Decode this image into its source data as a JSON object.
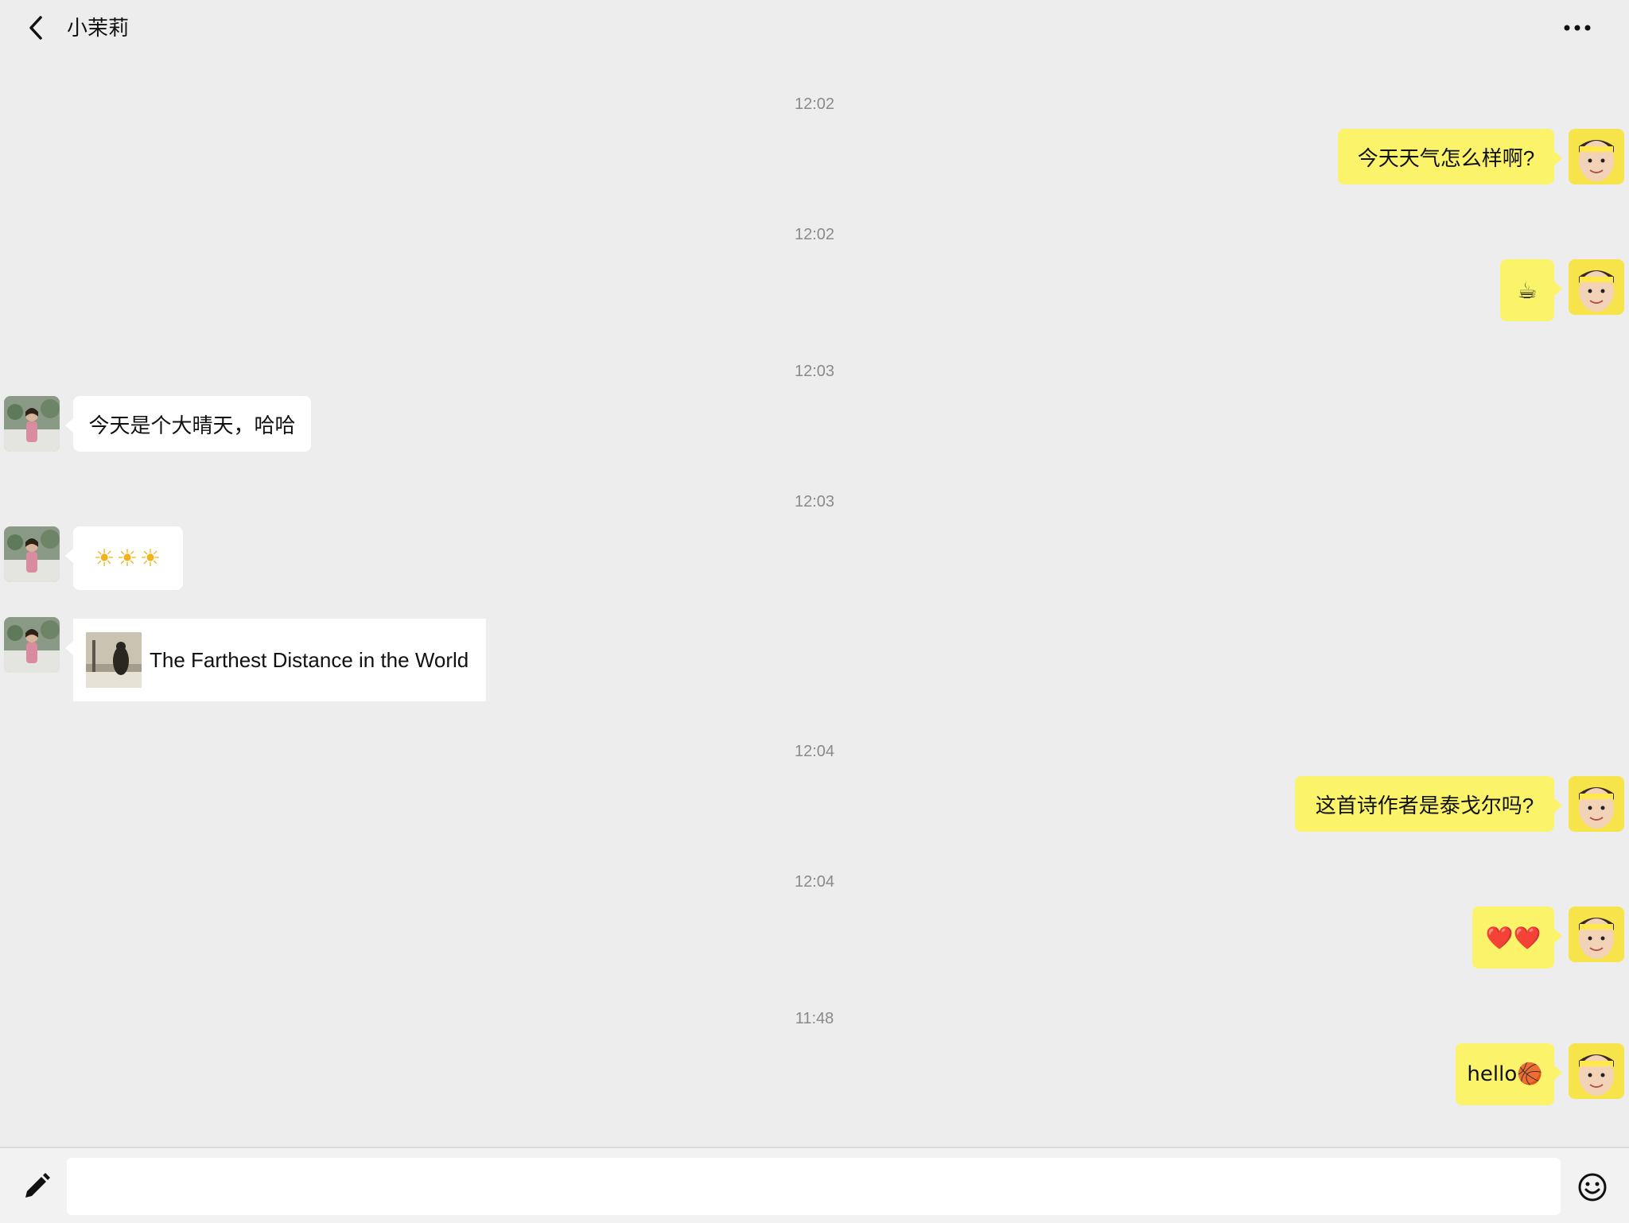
{
  "header": {
    "title": "小茉莉",
    "back_icon": "chevron-left-icon",
    "more_icon": "more-dots-icon"
  },
  "messages": [
    {
      "time": "12:02",
      "sender": "me",
      "type": "text",
      "text": "今天天气怎么样啊?"
    },
    {
      "time": "12:02",
      "sender": "me",
      "type": "emoji",
      "text": "☕"
    },
    {
      "time": "12:03",
      "sender": "them",
      "type": "text",
      "text": "今天是个大晴天，哈哈"
    },
    {
      "time": "12:03",
      "sender": "them",
      "type": "emoji",
      "text": "☀☀☀"
    },
    {
      "sender": "them",
      "type": "link-card",
      "text": "The Farthest Distance in the World"
    },
    {
      "time": "12:04",
      "sender": "me",
      "type": "text",
      "text": "这首诗作者是泰戈尔吗?"
    },
    {
      "time": "12:04",
      "sender": "me",
      "type": "emoji",
      "text": "❤️❤️"
    },
    {
      "time": "11:48",
      "sender": "me",
      "type": "text",
      "text": "hello🏀"
    }
  ],
  "composer": {
    "value": "",
    "placeholder": "",
    "pencil_icon": "pencil-icon",
    "emoji_icon": "smiley-icon"
  },
  "colors": {
    "background": "#ededed",
    "my_bubble": "#fbf46b",
    "their_bubble": "#ffffff",
    "timestamp": "#8a8a8a"
  }
}
